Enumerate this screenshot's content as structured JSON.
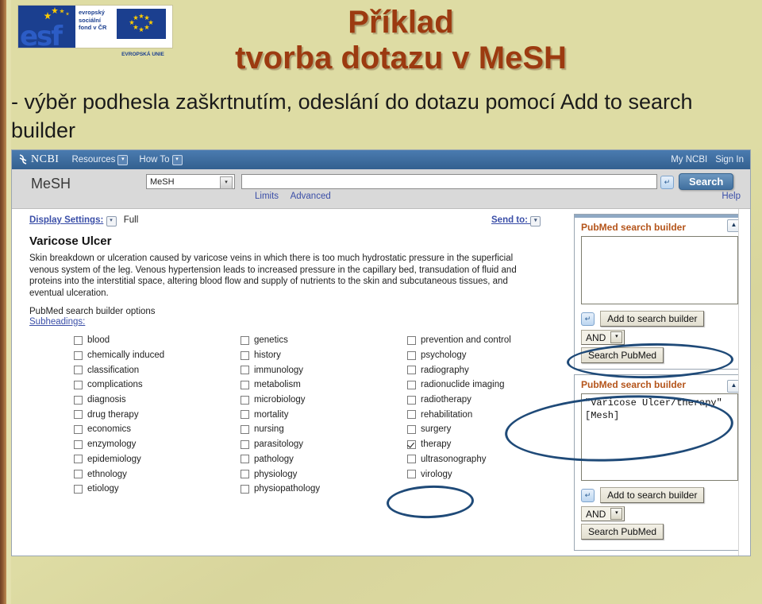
{
  "slide": {
    "logo": {
      "esf_letters": "esf",
      "esf_line1": "evropský",
      "esf_line2": "sociální",
      "esf_line3": "fond v ČR",
      "eu_caption": "EVROPSKÁ UNIE"
    },
    "title_line1": "Příklad",
    "title_line2": "tvorba dotazu v MeSH",
    "subtitle": "- výběr podhesla zaškrtnutím, odeslání do dotazu pomocí Add to search builder",
    "title_color": "#9c3a10",
    "background_color": "#dedca4"
  },
  "browser": {
    "ncbi": {
      "logo_text": "NCBI",
      "resources": "Resources",
      "how_to": "How To",
      "my_ncbi": "My NCBI",
      "sign_in": "Sign In",
      "bar_color": "#3e6ea5"
    },
    "search": {
      "app_name": "MeSH",
      "database_selected": "MeSH",
      "query_value": "",
      "query_placeholder": "",
      "button_label": "Search",
      "limits": "Limits",
      "advanced": "Advanced",
      "help": "Help"
    },
    "record": {
      "display_settings_label": "Display Settings:",
      "display_settings_value": "Full",
      "send_to_label": "Send to:",
      "term": "Varicose Ulcer",
      "description": "Skin breakdown or ulceration caused by varicose veins in which there is too much hydrostatic pressure in the superficial venous system of the leg. Venous hypertension leads to increased pressure in the capillary bed, transudation of fluid and proteins into the interstitial space, altering blood flow and supply of nutrients to the skin and subcutaneous tissues, and eventual ulceration.",
      "options_title": "PubMed search builder options",
      "subheadings_label": "Subheadings:"
    },
    "subheadings": {
      "column1": [
        {
          "label": "blood",
          "checked": false
        },
        {
          "label": "chemically induced",
          "checked": false
        },
        {
          "label": "classification",
          "checked": false
        },
        {
          "label": "complications",
          "checked": false
        },
        {
          "label": "diagnosis",
          "checked": false
        },
        {
          "label": "drug therapy",
          "checked": false
        },
        {
          "label": "economics",
          "checked": false
        },
        {
          "label": "enzymology",
          "checked": false
        },
        {
          "label": "epidemiology",
          "checked": false
        },
        {
          "label": "ethnology",
          "checked": false
        },
        {
          "label": "etiology",
          "checked": false
        }
      ],
      "column2": [
        {
          "label": "genetics",
          "checked": false
        },
        {
          "label": "history",
          "checked": false
        },
        {
          "label": "immunology",
          "checked": false
        },
        {
          "label": "metabolism",
          "checked": false
        },
        {
          "label": "microbiology",
          "checked": false
        },
        {
          "label": "mortality",
          "checked": false
        },
        {
          "label": "nursing",
          "checked": false
        },
        {
          "label": "parasitology",
          "checked": false
        },
        {
          "label": "pathology",
          "checked": false
        },
        {
          "label": "physiology",
          "checked": false
        },
        {
          "label": "physiopathology",
          "checked": false
        }
      ],
      "column3": [
        {
          "label": "prevention and control",
          "checked": false
        },
        {
          "label": "psychology",
          "checked": false
        },
        {
          "label": "radiography",
          "checked": false
        },
        {
          "label": "radionuclide imaging",
          "checked": false
        },
        {
          "label": "radiotherapy",
          "checked": false
        },
        {
          "label": "rehabilitation",
          "checked": false
        },
        {
          "label": "surgery",
          "checked": false
        },
        {
          "label": "therapy",
          "checked": true
        },
        {
          "label": "ultrasonography",
          "checked": false
        },
        {
          "label": "virology",
          "checked": false
        }
      ]
    },
    "panel_top": {
      "title": "PubMed search builder",
      "textarea_value": "",
      "add_button": "Add to search builder",
      "operator": "AND",
      "search_button": "Search PubMed"
    },
    "panel_bottom": {
      "title": "PubMed search builder",
      "textarea_value": "\"Varicose Ulcer/therapy\"\n[Mesh]",
      "add_button": "Add to search builder",
      "operator": "AND",
      "search_button": "Search PubMed"
    },
    "annotation_color": "#1f4a78"
  }
}
